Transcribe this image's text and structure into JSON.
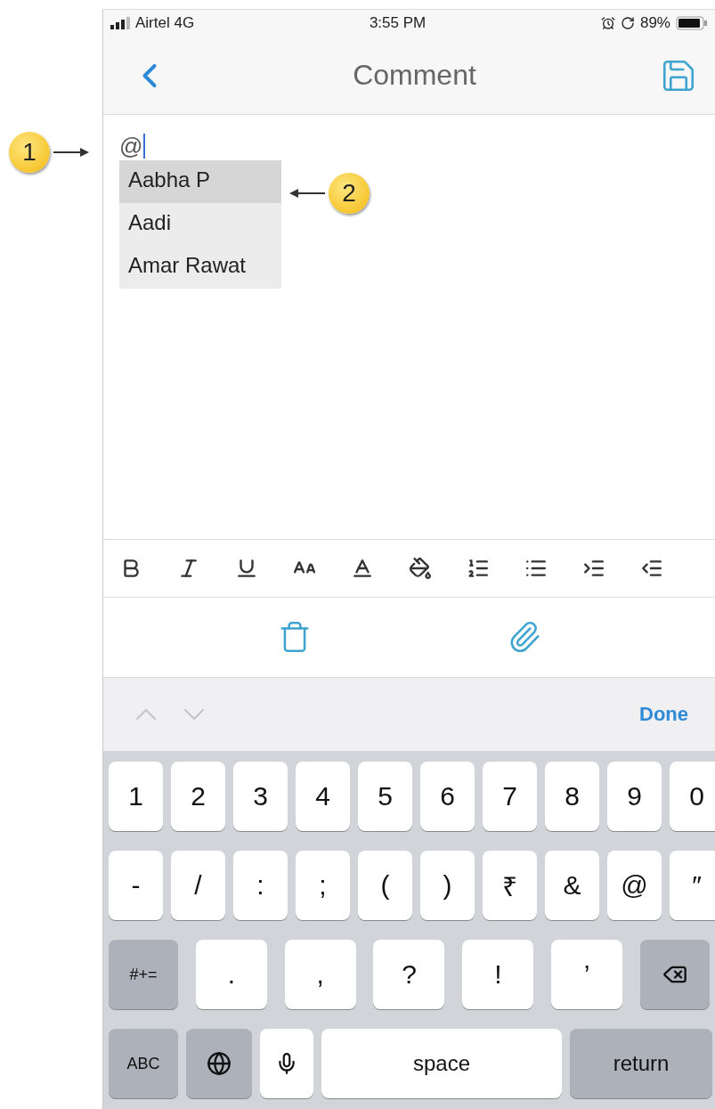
{
  "status_bar": {
    "carrier": "Airtel 4G",
    "time": "3:55 PM",
    "battery": "89%"
  },
  "nav": {
    "title": "Comment"
  },
  "editor": {
    "value": "@"
  },
  "mentions": [
    {
      "name": "Aabha P",
      "selected": true
    },
    {
      "name": "Aadi",
      "selected": false
    },
    {
      "name": "Amar Rawat",
      "selected": false
    }
  ],
  "callouts": [
    {
      "number": "1"
    },
    {
      "number": "2"
    }
  ],
  "toolbar": [
    {
      "kind": "bold"
    },
    {
      "kind": "italic"
    },
    {
      "kind": "underline"
    },
    {
      "kind": "size"
    },
    {
      "kind": "color"
    },
    {
      "kind": "fill"
    },
    {
      "kind": "ordered"
    },
    {
      "kind": "bullets"
    },
    {
      "kind": "indent"
    },
    {
      "kind": "outdent"
    }
  ],
  "accessory": {
    "done": "Done"
  },
  "keyboard": [
    [
      {
        "kind": "key",
        "label": "1"
      },
      {
        "kind": "key",
        "label": "2"
      },
      {
        "kind": "key",
        "label": "3"
      },
      {
        "kind": "key",
        "label": "4"
      },
      {
        "kind": "key",
        "label": "5"
      },
      {
        "kind": "key",
        "label": "6"
      },
      {
        "kind": "key",
        "label": "7"
      },
      {
        "kind": "key",
        "label": "8"
      },
      {
        "kind": "key",
        "label": "9"
      },
      {
        "kind": "key",
        "label": "0"
      }
    ],
    [
      {
        "kind": "key",
        "label": "-"
      },
      {
        "kind": "key",
        "label": "/"
      },
      {
        "kind": "key",
        "label": ":"
      },
      {
        "kind": "key",
        "label": ";"
      },
      {
        "kind": "key",
        "label": "("
      },
      {
        "kind": "key",
        "label": ")"
      },
      {
        "kind": "key",
        "label": "₹"
      },
      {
        "kind": "key",
        "label": "&"
      },
      {
        "kind": "key",
        "label": "@"
      },
      {
        "kind": "key",
        "label": "″"
      }
    ],
    [
      {
        "kind": "mod",
        "label": "#+="
      },
      {
        "kind": "key",
        "label": "."
      },
      {
        "kind": "key",
        "label": ","
      },
      {
        "kind": "key",
        "label": "?"
      },
      {
        "kind": "key",
        "label": "!"
      },
      {
        "kind": "key",
        "label": "’"
      },
      {
        "kind": "backspace"
      }
    ],
    [
      {
        "kind": "mod",
        "label": "ABC"
      },
      {
        "kind": "globe"
      },
      {
        "kind": "mic"
      },
      {
        "kind": "space",
        "label": "space"
      },
      {
        "kind": "return",
        "label": "return"
      }
    ]
  ]
}
